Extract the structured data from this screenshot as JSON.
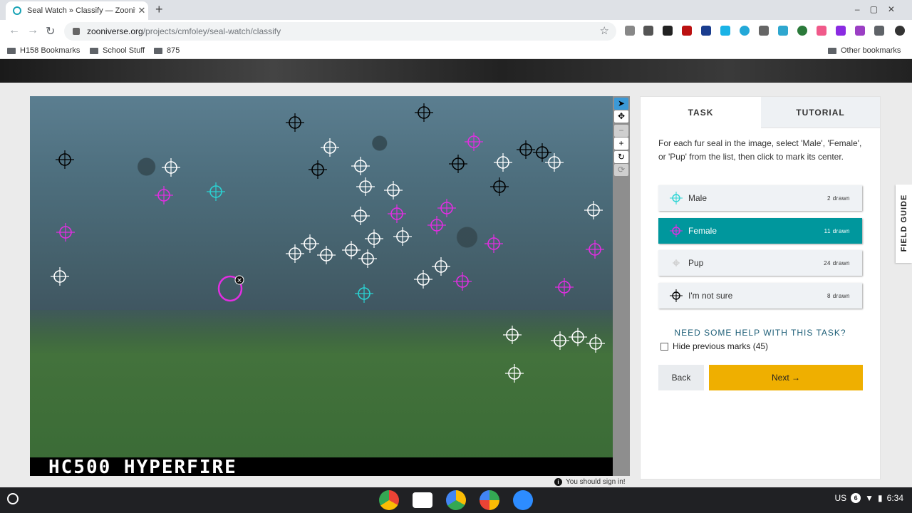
{
  "browser": {
    "tab_title": "Seal Watch » Classify — Zooniverse",
    "url_host": "zooniverse.org",
    "url_path": "/projects/cmfoley/seal-watch/classify",
    "bookmarks": [
      "H158 Bookmarks",
      "School Stuff",
      "875"
    ],
    "other_bookmarks": "Other bookmarks"
  },
  "viewer": {
    "camera_stamp": "HC500  HYPERFIRE",
    "tools": [
      "pointer-icon",
      "move-icon",
      "zoom-out-icon",
      "zoom-in-icon",
      "rotate-icon",
      "reset-icon"
    ]
  },
  "panel": {
    "tabs": [
      "TASK",
      "TUTORIAL"
    ],
    "instructions": "For each fur seal in the image, select 'Male', 'Female', or 'Pup' from the list, then click to mark its center.",
    "options": [
      {
        "label": "Male",
        "count": "2 drawn",
        "color": "#2ad4d4"
      },
      {
        "label": "Female",
        "count": "11 drawn",
        "color": "#e22ee2"
      },
      {
        "label": "Pup",
        "count": "24 drawn",
        "color": "#ffffff"
      },
      {
        "label": "I'm not sure",
        "count": "8 drawn",
        "color": "#000000"
      }
    ],
    "help": "NEED SOME HELP WITH THIS TASK?",
    "hide_marks": "Hide previous marks (45)",
    "back": "Back",
    "next": "Next →"
  },
  "field_guide": "FIELD GUIDE",
  "signin_notice": "You should sign in!",
  "taskbar": {
    "locale": "US",
    "notifications": "6",
    "time": "6:34"
  },
  "colors": {
    "accent": "#00979d",
    "next": "#efaf00",
    "help": "#1d5e77"
  }
}
